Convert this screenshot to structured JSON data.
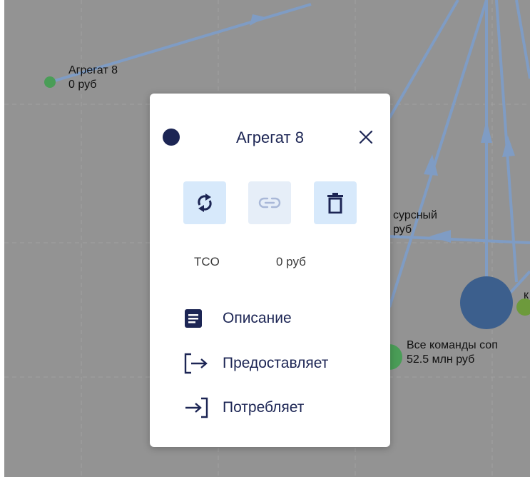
{
  "graph": {
    "nodes": [
      {
        "label_line1": "Агрегат 8",
        "label_line2": "0 руб"
      },
      {
        "label_line1": "сурсный",
        "label_line2": "руб"
      },
      {
        "label_line1": "Все команды соп",
        "label_line2": "52.5 млн руб"
      },
      {
        "label_line1": "к",
        "label_line2": ""
      }
    ]
  },
  "colors": {
    "background": "#939393",
    "edge": "#7f9cc4",
    "node_green": "#4a9d57",
    "node_big": "#3c5f8d",
    "node_dark": "#1c2554",
    "button_bg": "#d7e9fb"
  },
  "popup": {
    "title": "Агрегат 8",
    "close_icon": "close-icon",
    "actions": [
      {
        "name": "refresh",
        "icon": "refresh-icon"
      },
      {
        "name": "link",
        "icon": "link-icon",
        "disabled": true
      },
      {
        "name": "delete",
        "icon": "trash-icon"
      }
    ],
    "stats": {
      "tco_label": "TCO",
      "tco_value": "0 руб"
    },
    "menu": [
      {
        "label": "Описание",
        "icon": "document-icon"
      },
      {
        "label": "Предоставляет",
        "icon": "provide-icon"
      },
      {
        "label": "Потребляет",
        "icon": "consume-icon"
      }
    ]
  }
}
